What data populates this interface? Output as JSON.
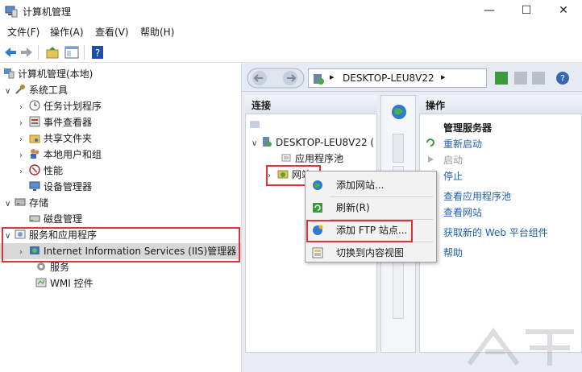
{
  "window": {
    "title": "计算机管理",
    "controls": [
      "minimize",
      "maximize",
      "close"
    ]
  },
  "menu": [
    "文件(F)",
    "操作(A)",
    "查看(V)",
    "帮助(H)"
  ],
  "tree": {
    "root": "计算机管理(本地)",
    "system_tools": "系统工具",
    "task_scheduler": "任务计划程序",
    "event_viewer": "事件查看器",
    "shared_folders": "共享文件夹",
    "local_users": "本地用户和组",
    "performance": "性能",
    "device_manager": "设备管理器",
    "storage": "存储",
    "disk_management": "磁盘管理",
    "services_apps": "服务和应用程序",
    "iis_manager": "Internet Information Services (IIS)管理器",
    "services": "服务",
    "wmi": "WMI 控件"
  },
  "iis": {
    "address": "DESKTOP-LEU8V22",
    "address_sep": "▸",
    "connections_title": "连接",
    "server_node": "DESKTOP-LEU8V22 (",
    "app_pools": "应用程序池",
    "sites": "网站",
    "actions_title": "操作",
    "manage_server": "管理服务器",
    "restart": "重新启动",
    "start": "启动",
    "stop": "停止",
    "view_app_pools": "查看应用程序池",
    "view_sites": "查看网站",
    "get_web_components": "获取新的 Web 平台组件",
    "help": "帮助"
  },
  "context_menu": {
    "add_website": "添加网站...",
    "refresh": "刷新(R)",
    "add_ftp": "添加 FTP 站点...",
    "switch_content_view": "切换到内容视图"
  },
  "colors": {
    "highlight_red": "#e0323a",
    "link_blue": "#1f5fae"
  }
}
